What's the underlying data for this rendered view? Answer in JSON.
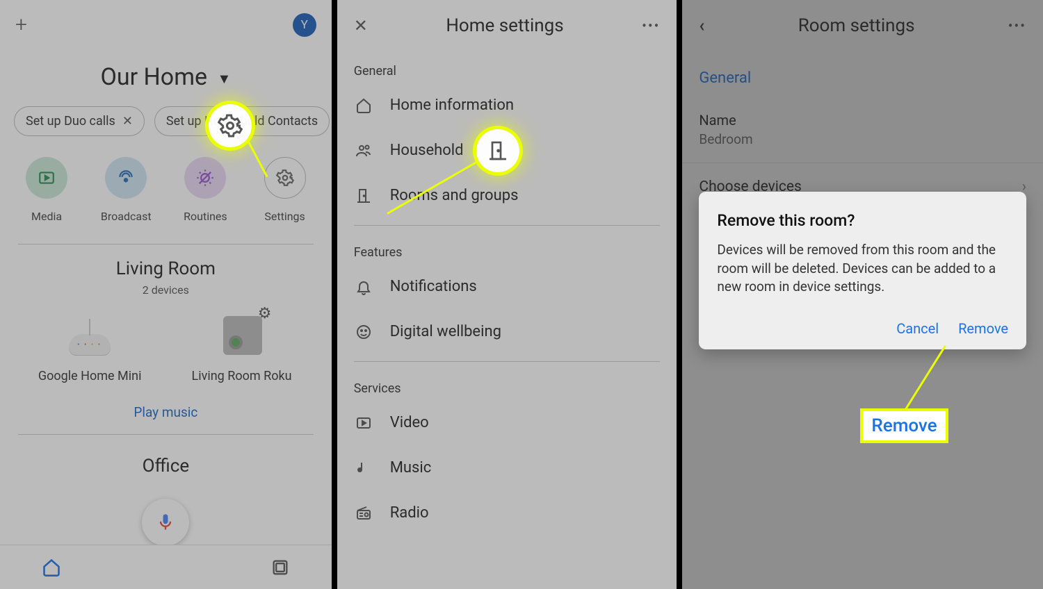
{
  "screen1": {
    "avatar_initial": "Y",
    "home_name": "Our Home",
    "chips": [
      "Set up Duo calls",
      "Set up Household Contacts"
    ],
    "quick_actions": [
      {
        "id": "media",
        "label": "Media"
      },
      {
        "id": "broadcast",
        "label": "Broadcast"
      },
      {
        "id": "routines",
        "label": "Routines"
      },
      {
        "id": "settings",
        "label": "Settings"
      }
    ],
    "rooms": [
      {
        "name": "Living Room",
        "subtitle": "2 devices",
        "devices": [
          {
            "label": "Google Home Mini"
          },
          {
            "label": "Living Room Roku"
          }
        ],
        "action": "Play music"
      },
      {
        "name": "Office"
      }
    ]
  },
  "screen2": {
    "title": "Home settings",
    "sections": [
      {
        "heading": "General",
        "items": [
          {
            "label": "Home information"
          },
          {
            "label": "Household"
          },
          {
            "label": "Rooms and groups"
          }
        ]
      },
      {
        "heading": "Features",
        "items": [
          {
            "label": "Notifications"
          },
          {
            "label": "Digital wellbeing"
          }
        ]
      },
      {
        "heading": "Services",
        "items": [
          {
            "label": "Video"
          },
          {
            "label": "Music"
          },
          {
            "label": "Radio"
          }
        ]
      }
    ]
  },
  "screen3": {
    "title": "Room settings",
    "section": "General",
    "name_label": "Name",
    "name_value": "Bedroom",
    "choose_label": "Choose devices",
    "dialog": {
      "title": "Remove this room?",
      "body": "Devices will be removed from this room and the room will be deleted. Devices can be added to a new room in device settings.",
      "cancel": "Cancel",
      "remove": "Remove"
    },
    "highlight": "Remove"
  }
}
